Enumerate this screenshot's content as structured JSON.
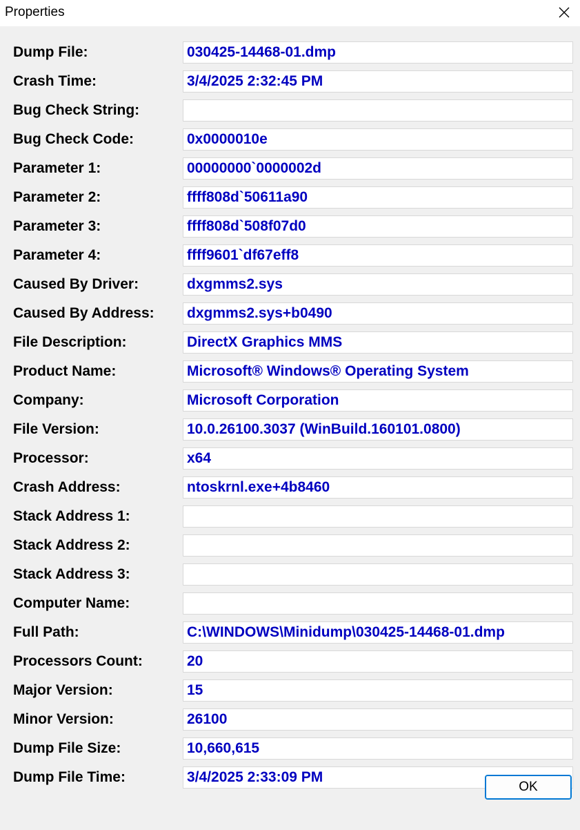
{
  "window": {
    "title": "Properties",
    "close_icon": "close-icon"
  },
  "colors": {
    "value_text": "#0000c0",
    "label_text": "#000000",
    "background": "#f0f0f0",
    "field_background": "#ffffff",
    "button_border": "#0078d4"
  },
  "properties": [
    {
      "label": "Dump File:",
      "value": "030425-14468-01.dmp"
    },
    {
      "label": "Crash Time:",
      "value": "3/4/2025 2:32:45 PM"
    },
    {
      "label": "Bug Check String:",
      "value": ""
    },
    {
      "label": "Bug Check Code:",
      "value": "0x0000010e"
    },
    {
      "label": "Parameter 1:",
      "value": "00000000`0000002d"
    },
    {
      "label": "Parameter 2:",
      "value": "ffff808d`50611a90"
    },
    {
      "label": "Parameter 3:",
      "value": "ffff808d`508f07d0"
    },
    {
      "label": "Parameter 4:",
      "value": "ffff9601`df67eff8"
    },
    {
      "label": "Caused By Driver:",
      "value": "dxgmms2.sys"
    },
    {
      "label": "Caused By Address:",
      "value": "dxgmms2.sys+b0490"
    },
    {
      "label": "File Description:",
      "value": "DirectX Graphics MMS"
    },
    {
      "label": "Product Name:",
      "value": "Microsoft® Windows® Operating System"
    },
    {
      "label": "Company:",
      "value": "Microsoft Corporation"
    },
    {
      "label": "File Version:",
      "value": "10.0.26100.3037 (WinBuild.160101.0800)"
    },
    {
      "label": "Processor:",
      "value": "x64"
    },
    {
      "label": "Crash Address:",
      "value": "ntoskrnl.exe+4b8460"
    },
    {
      "label": "Stack Address 1:",
      "value": ""
    },
    {
      "label": "Stack Address 2:",
      "value": ""
    },
    {
      "label": "Stack Address 3:",
      "value": ""
    },
    {
      "label": "Computer Name:",
      "value": ""
    },
    {
      "label": "Full Path:",
      "value": "C:\\WINDOWS\\Minidump\\030425-14468-01.dmp"
    },
    {
      "label": "Processors Count:",
      "value": "20"
    },
    {
      "label": "Major Version:",
      "value": "15"
    },
    {
      "label": "Minor Version:",
      "value": "26100"
    },
    {
      "label": "Dump File Size:",
      "value": "10,660,615"
    },
    {
      "label": "Dump File Time:",
      "value": "3/4/2025 2:33:09 PM"
    }
  ],
  "buttons": {
    "ok_label": "OK"
  }
}
